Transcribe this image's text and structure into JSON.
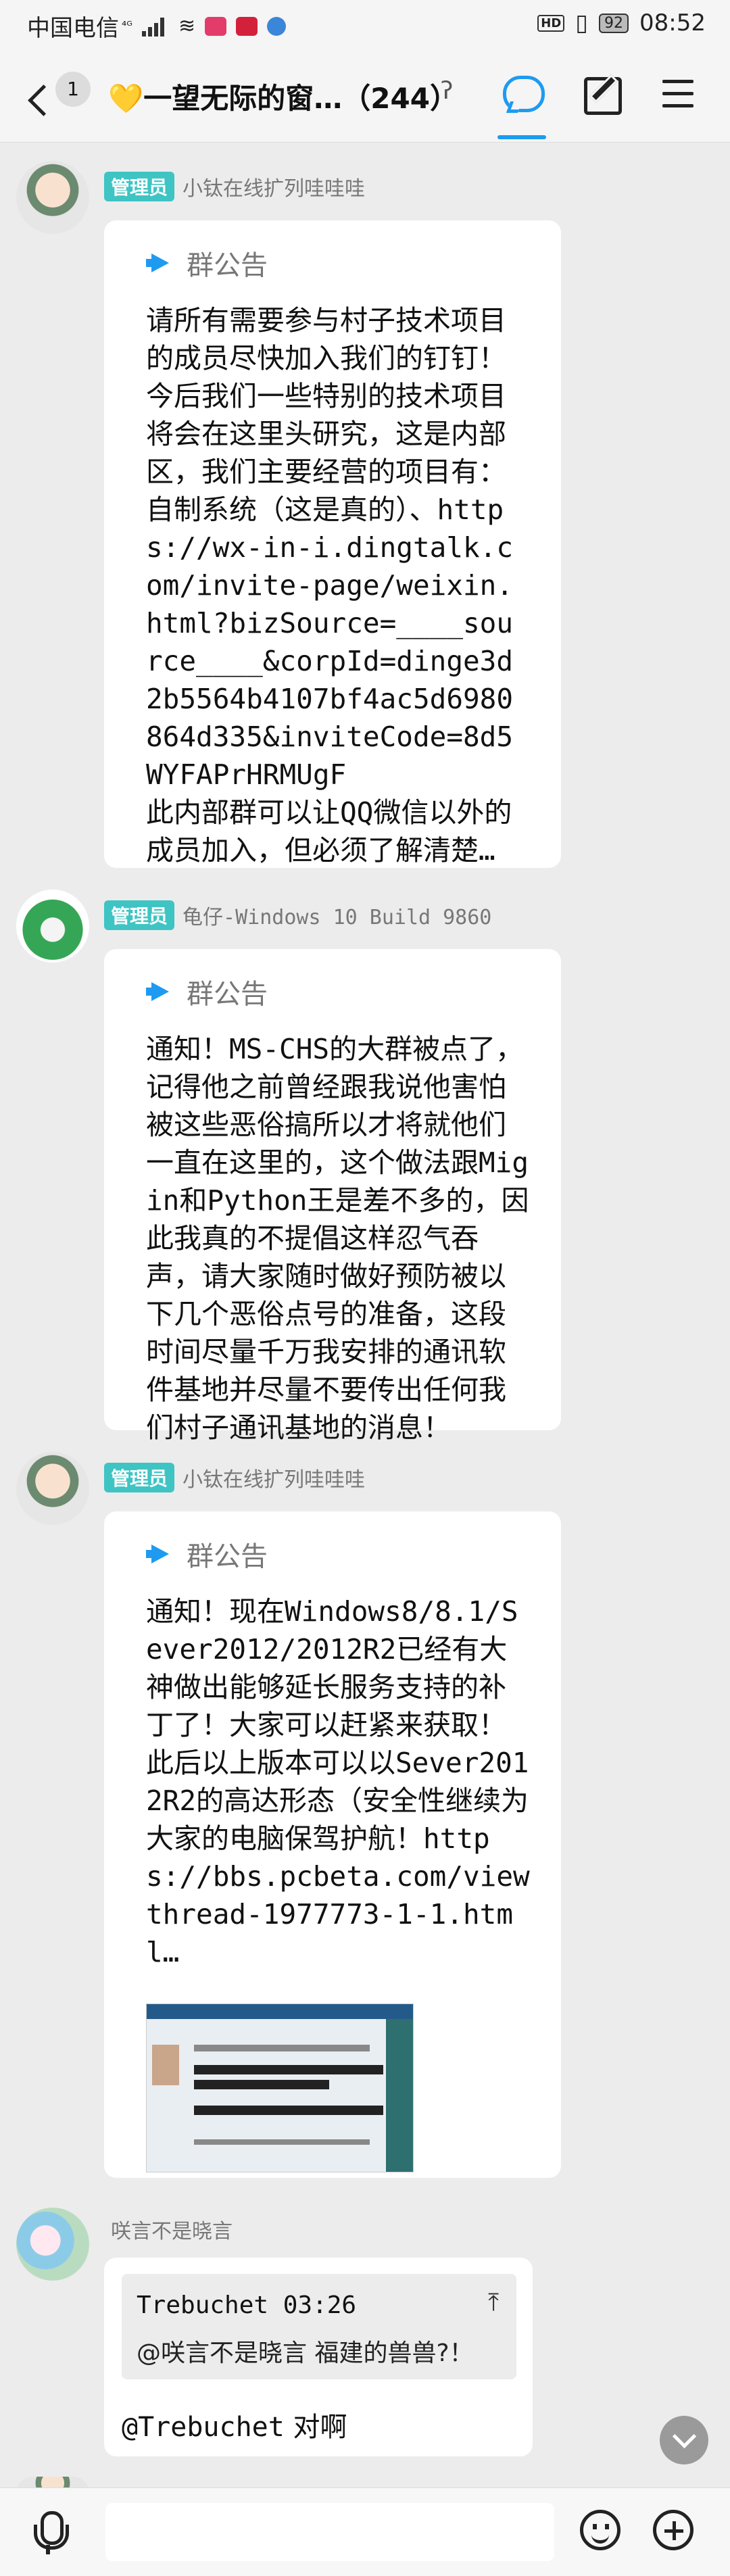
{
  "status_bar": {
    "carrier": "中国电信",
    "net": "⁴ᴳ",
    "hd": "HD",
    "battery": "92",
    "time": "08:52"
  },
  "nav": {
    "unread_count": "1",
    "title_prefix": "💛",
    "title": "一望无际的窗…（244）",
    "ear_icon": "ear-icon",
    "chat_icon": "chat-bubble-icon",
    "edit_icon": "edit-note-icon",
    "menu_icon": "hamburger-menu-icon"
  },
  "messages": [
    {
      "role": "管理员",
      "sender": "小钛在线扩列哇哇哇",
      "announcement_label": "群公告",
      "body": "请所有需要参与村子技术项目的成员尽快加入我们的钉钉！今后我们一些特别的技术项目将会在这里头研究，这是内部区，我们主要经营的项目有：自制系统（这是真的）、https://wx-in-i.dingtalk.com/invite-page/weixin.html?bizSource=____source____&corpId=dinge3d2b5564b4107bf4ac5d6980864d335&inviteCode=8d5WYFAPrHRMUgF\n此内部群可以让QQ微信以外的成员加入，但必须了解清楚…"
    },
    {
      "role": "管理员",
      "sender": "龟仔-Windows 10 Build 9860",
      "announcement_label": "群公告",
      "body": "通知！MS-CHS的大群被点了，记得他之前曾经跟我说他害怕被这些恶俗搞所以才将就他们一直在这里的，这个做法跟Migin和Python王是差不多的，因此我真的不提倡这样忍气吞声，请大家随时做好预防被以下几个恶俗点号的准备，这段时间尽量千万我安排的通讯软件基地并尽量不要传出任何我们村子通讯基地的消息！"
    },
    {
      "role": "管理员",
      "sender": "小钛在线扩列哇哇哇",
      "announcement_label": "群公告",
      "body": "通知！现在Windows8/8.1/Sever2012/2012R2已经有大神做出能够延长服务支持的补丁了！大家可以赶紧来获取！此后以上版本可以以Sever2012R2的高达形态（安全性继续为大家的电脑保驾护航！https://bbs.pcbeta.com/viewthread-1977773-1-1.html…"
    },
    {
      "sender": "咲言不是晓言",
      "quote_author": "Trebuchet 03:26",
      "quote_text": "@咲言不是晓言 福建的兽兽?！",
      "reply_mention": "@Trebuchet",
      "reply_text": "对啊"
    }
  ],
  "input": {
    "placeholder": ""
  }
}
